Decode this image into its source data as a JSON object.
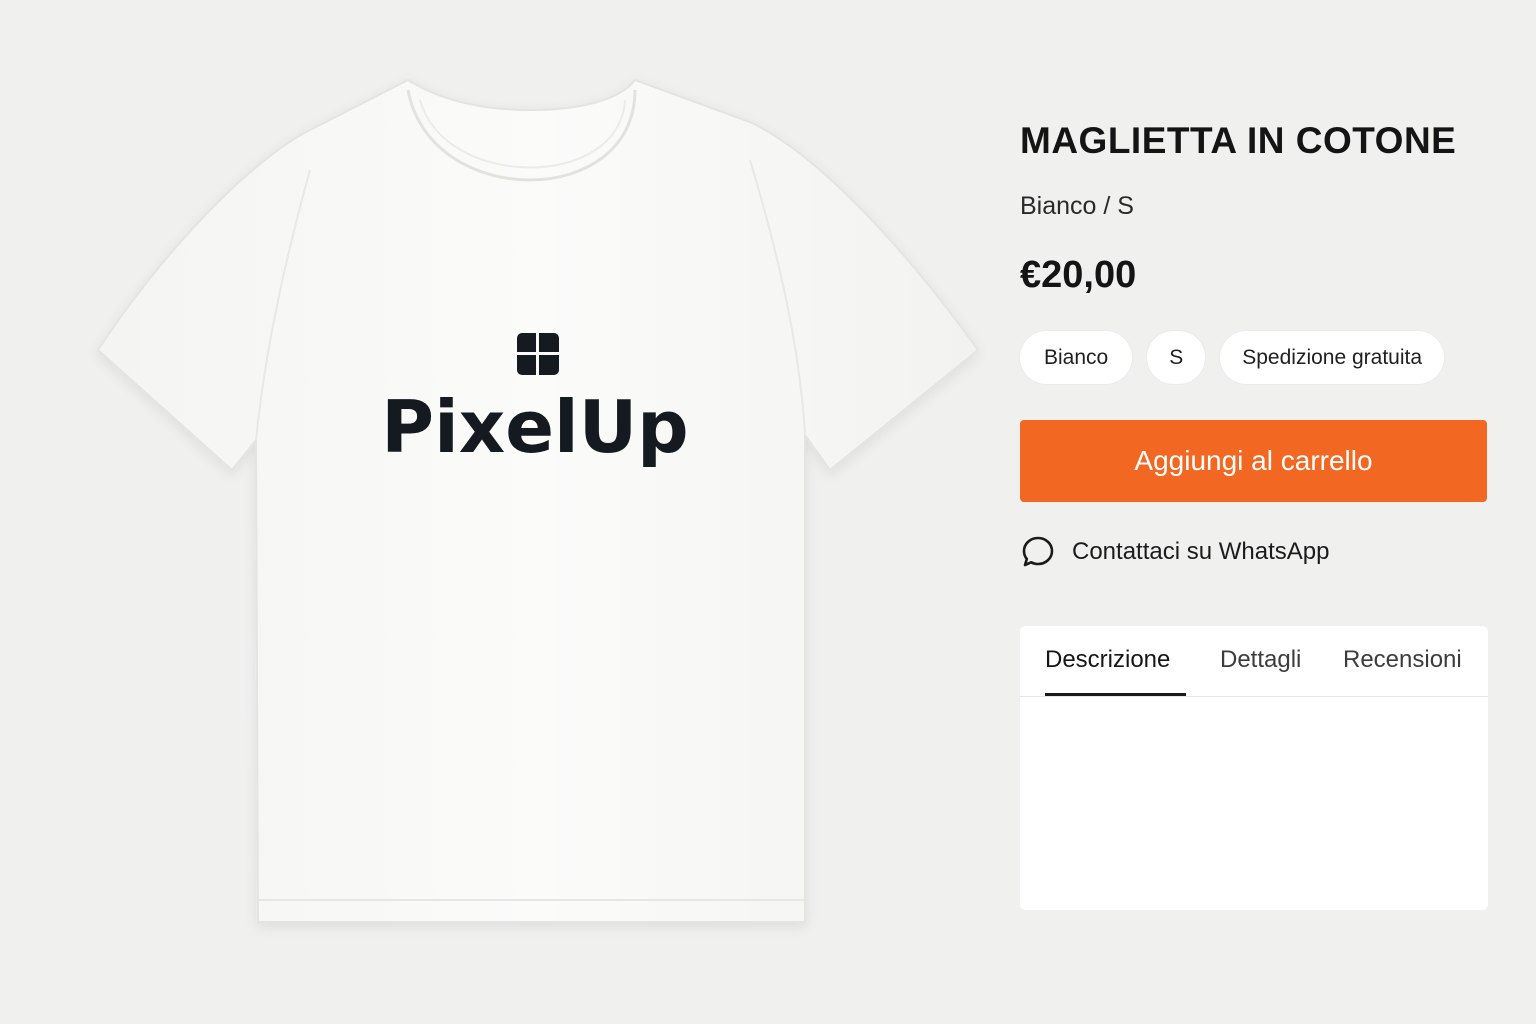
{
  "product": {
    "title": "MAGLIETTA IN COTONE",
    "variant": "Bianco / S",
    "price": "€20,00",
    "image": {
      "logo_icon": "window-grid-icon",
      "logo_text": "PixelUp"
    }
  },
  "chips": [
    "Bianco",
    "S",
    "Spedizione gratuita"
  ],
  "actions": {
    "add_to_cart": "Aggiungi al carrello",
    "whatsapp": "Contattaci su WhatsApp",
    "whatsapp_icon": "chat-bubble-icon"
  },
  "tabs": {
    "items": [
      "Descrizione",
      "Dettagli",
      "Recensioni"
    ],
    "active": "Descrizione"
  },
  "colors": {
    "accent": "#f26722",
    "background": "#f0f0ef",
    "text": "#141414"
  }
}
